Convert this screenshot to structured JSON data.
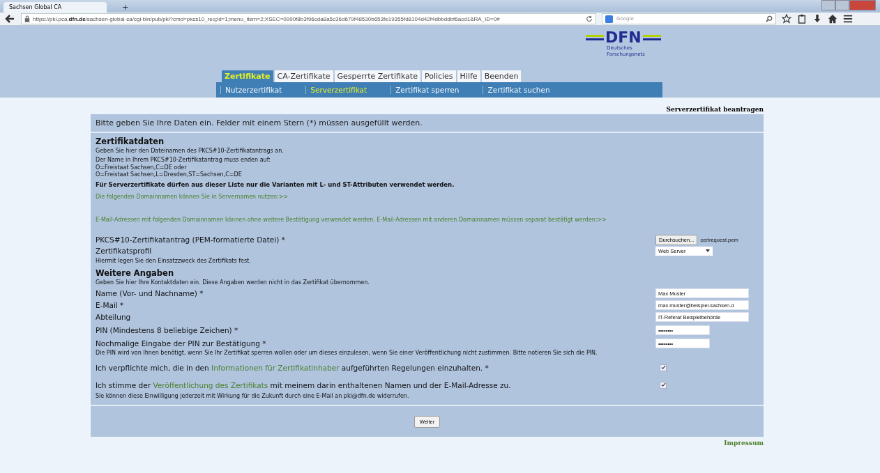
{
  "browser": {
    "tab_title": "Sachsen Global CA",
    "new_tab": "+",
    "url_prefix": "https://pki.pca.",
    "url_domain": "dfn.de",
    "url_rest": "/sachsen-global-ca/cgi-bin/pub/pki?cmd=pkcs10_req;id=1;menu_item=2;XSEC=0990f8b3f96cda8a5c36d679f48530b653fe19355fd8104d42f4dbbddbf6acd1&RA_ID=0#",
    "search_placeholder": "Google"
  },
  "logo": {
    "name": "DFN",
    "subtitle_lines": [
      "Deutsches",
      "Forschungsnetz"
    ]
  },
  "tabs": [
    {
      "label": "Zertifikate",
      "selected": true
    },
    {
      "label": "CA-Zertifikate",
      "selected": false
    },
    {
      "label": "Gesperrte Zertifikate",
      "selected": false
    },
    {
      "label": "Policies",
      "selected": false
    },
    {
      "label": "Hilfe",
      "selected": false
    },
    {
      "label": "Beenden",
      "selected": false
    }
  ],
  "subtabs": [
    {
      "label": "Nutzerzertifikat",
      "selected": false
    },
    {
      "label": "Serverzertifikat",
      "selected": true
    },
    {
      "label": "Zertifikat sperren",
      "selected": false
    },
    {
      "label": "Zertifikat suchen",
      "selected": false
    }
  ],
  "page_title": "Serverzertifikat beantragen",
  "intro": "Bitte geben Sie Ihre Daten ein. Felder mit einem Stern (*) müssen ausgefüllt werden.",
  "cert_section": {
    "heading": "Zertifikatdaten",
    "lines": [
      "Geben Sie hier den Dateinamen des PKCS#10-Zertifikatantrags an.",
      "Der Name in Ihrem PKCS#10-Zertifikatantrag muss enden auf:"
    ],
    "dn_lines": [
      "O=Freistaat Sachsen,C=DE oder",
      "O=Freistaat Sachsen,L=Dresden,ST=Sachsen,C=DE"
    ],
    "notice": "Für Serverzertifikate dürfen aus dieser Liste nur die Varianten mit L- und ST-Attributen verwendet werden.",
    "links": [
      "Die folgenden Domainnamen können Sie in Servernamen nutzen:>>",
      "E-Mail-Adressen mit folgenden Domainnamen können ohne weitere Bestätigung verwendet werden. E-Mail-Adressen mit anderen Domainnamen müssen separat bestätigt werden:>>"
    ]
  },
  "file_field": {
    "label": "PKCS#10-Zertifikatantrag (PEM-formatierte Datei) *",
    "button": "Durchsuchen...",
    "filename": "certrequest.pem"
  },
  "profile_field": {
    "label": "Zertifikatsprofil",
    "value": "Web Server",
    "hint": "Hiermit legen Sie den Einsatzzweck des Zertifikats fest."
  },
  "more_section": {
    "heading": "Weitere Angaben",
    "hint": "Geben Sie hier Ihre Kontaktdaten ein. Diese Angaben werden nicht in das Zertifikat übernommen."
  },
  "fields": [
    {
      "label": "Name (Vor- und Nachname) *",
      "value": "Max Muster",
      "kind": "text"
    },
    {
      "label": "E-Mail *",
      "value": "max.muster@beispiel.sachsen.d",
      "kind": "text"
    },
    {
      "label": "Abteilung",
      "value": "IT-Referat Beispielbehörde",
      "kind": "text"
    },
    {
      "label": "PIN (Mindestens 8 beliebige Zeichen) *",
      "value": "••••••••",
      "kind": "pin"
    },
    {
      "label": "Nochmalige Eingabe der PIN zur Bestätigung *",
      "value": "••••••••",
      "kind": "pin"
    }
  ],
  "pin_hint": "Die PIN wird von Ihnen benötigt, wenn Sie Ihr Zertifikat sperren wollen oder um dieses einzulesen, wenn Sie einer Veröffentlichung nicht zustimmen. Bitte notieren Sie sich die PIN.",
  "consents": [
    {
      "before": "Ich verpflichte mich, die in den ",
      "link": "Informationen für Zertifikatinhaber",
      "after": " aufgeführten Regelungen einzuhalten. *",
      "checked": true
    },
    {
      "before": "Ich stimme der ",
      "link": "Veröffentlichung des Zertifikats",
      "after": " mit meinem darin enthaltenen Namen und der E-Mail-Adresse zu.",
      "checked": true
    }
  ],
  "consent_hint": "Sie können diese Einwilligung jederzeit mit Wirkung für die Zukunft durch eine E-Mail an pki@dfn.de widerrufen.",
  "submit": "Weiter",
  "footer_link": "Impressum"
}
